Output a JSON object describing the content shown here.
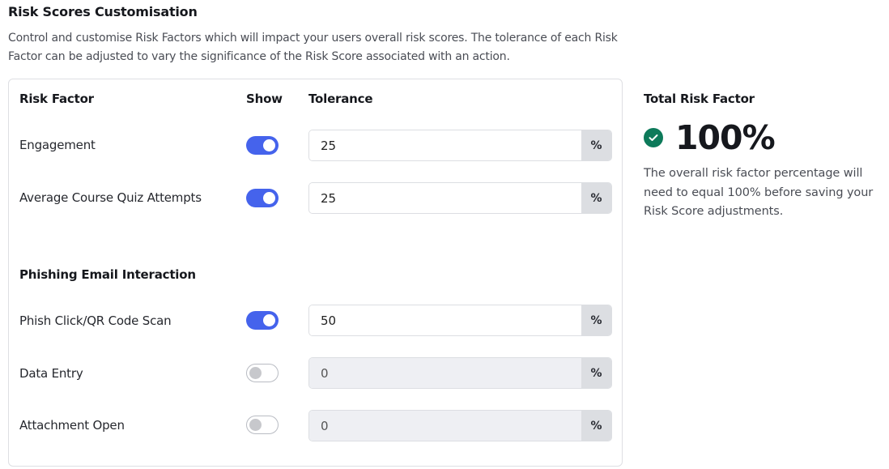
{
  "page": {
    "title": "Risk Scores Customisation",
    "description": "Control and customise Risk Factors which will impact your users overall risk scores. The tolerance of each Risk Factor can be adjusted to vary the significance of the Risk Score associated with an action."
  },
  "table": {
    "headers": {
      "risk_factor": "Risk Factor",
      "show": "Show",
      "tolerance": "Tolerance"
    },
    "unit_symbol": "%",
    "rows": [
      {
        "label": "Engagement",
        "show": true,
        "tolerance": "25",
        "disabled": false
      },
      {
        "label": "Average Course Quiz Attempts",
        "show": true,
        "tolerance": "25",
        "disabled": false
      }
    ],
    "groups": [
      {
        "label": "Phishing Email Interaction",
        "rows": [
          {
            "label": "Phish Click/QR Code Scan",
            "show": true,
            "tolerance": "50",
            "disabled": false
          },
          {
            "label": "Data Entry",
            "show": false,
            "tolerance": "0",
            "disabled": true
          },
          {
            "label": "Attachment Open",
            "show": false,
            "tolerance": "0",
            "disabled": true
          }
        ]
      }
    ]
  },
  "summary": {
    "title": "Total Risk Factor",
    "total": "100%",
    "status_icon": "check-circle-icon",
    "status_color": "#0d7a5a",
    "note": "The overall risk factor percentage will need to equal 100% before saving your Risk Score adjustments."
  },
  "colors": {
    "accent": "#4563ec",
    "success": "#0d7a5a"
  }
}
